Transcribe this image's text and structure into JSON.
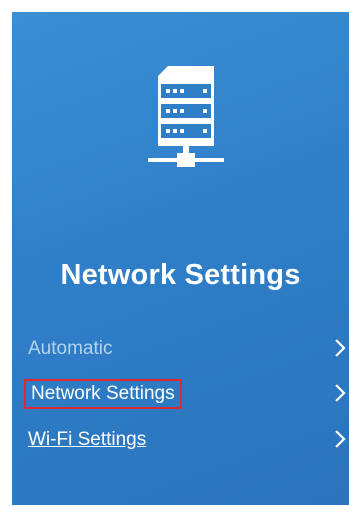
{
  "panel": {
    "title": "Network Settings",
    "icon": "network-server-icon",
    "background_color": "#2f7fc8"
  },
  "menu": {
    "items": [
      {
        "label": "Automatic",
        "state": "disabled",
        "icon": "chevron-right-icon"
      },
      {
        "label": "Network Settings",
        "state": "selected",
        "icon": "chevron-right-icon",
        "highlight_color": "#e0282e"
      },
      {
        "label": "Wi-Fi Settings",
        "state": "link",
        "icon": "chevron-right-icon"
      }
    ]
  }
}
